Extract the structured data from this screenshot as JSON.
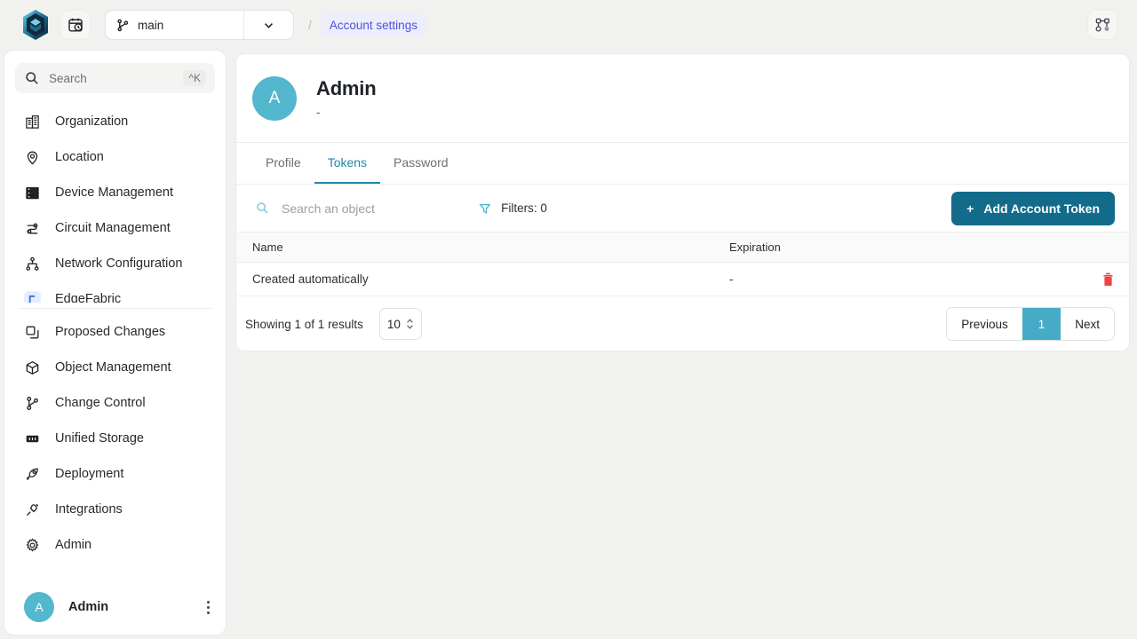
{
  "topbar": {
    "logo_icon": "hexagon-logo-icon",
    "history_icon": "calendar-clock-icon",
    "branch": {
      "icon": "branch-icon",
      "label": "main",
      "caret_icon": "chevron-down-icon"
    },
    "breadcrumb_separator": "/",
    "breadcrumb_current": "Account settings",
    "topology_icon": "topology-nodes-icon"
  },
  "sidebar": {
    "search": {
      "icon": "search-icon",
      "placeholder": "Search",
      "shortcut": "^K"
    },
    "items_upper": [
      {
        "label": "Organization",
        "icon": "building-icon"
      },
      {
        "label": "Location",
        "icon": "map-pin-icon"
      },
      {
        "label": "Device Management",
        "icon": "server-rack-icon"
      },
      {
        "label": "Circuit Management",
        "icon": "circuit-icon"
      },
      {
        "label": "Network Configuration",
        "icon": "network-tree-icon"
      },
      {
        "label": "EdgeFabric",
        "icon": "edge-fabric-icon"
      }
    ],
    "items_lower": [
      {
        "label": "Proposed Changes",
        "icon": "copy-pages-icon"
      },
      {
        "label": "Object Management",
        "icon": "cube-icon"
      },
      {
        "label": "Change Control",
        "icon": "branch-icon"
      },
      {
        "label": "Unified Storage",
        "icon": "storage-icon"
      },
      {
        "label": "Deployment",
        "icon": "rocket-icon"
      },
      {
        "label": "Integrations",
        "icon": "plug-icon"
      },
      {
        "label": "Admin",
        "icon": "gear-icon"
      }
    ],
    "footer": {
      "avatar_initial": "A",
      "name": "Admin",
      "menu_icon": "kebab-menu-icon"
    }
  },
  "main": {
    "header": {
      "avatar_initial": "A",
      "title": "Admin",
      "subtitle": "-"
    },
    "tabs": [
      {
        "label": "Profile",
        "active": false
      },
      {
        "label": "Tokens",
        "active": true
      },
      {
        "label": "Password",
        "active": false
      }
    ],
    "toolbar": {
      "search_icon": "search-icon",
      "search_placeholder": "Search an object",
      "filter_icon": "filter-icon",
      "filters_label": "Filters: 0",
      "add_button": {
        "plus": "+",
        "label": "Add Account Token"
      }
    },
    "table": {
      "columns": [
        "Name",
        "Expiration"
      ],
      "rows": [
        {
          "name": "Created automatically",
          "expiration": "-",
          "delete_icon": "trash-icon"
        }
      ]
    },
    "footer": {
      "showing": "Showing 1 of 1 results",
      "page_size": "10",
      "page_size_caret": "stepper-icon",
      "previous": "Previous",
      "current_page": "1",
      "next": "Next"
    }
  },
  "colors": {
    "accent_teal": "#1e89ab",
    "button_teal": "#136b8b",
    "page_active": "#47aac6",
    "avatar": "#53b7ce",
    "breadcrumb_badge_bg": "#eceefc",
    "breadcrumb_badge_text": "#4f52d8",
    "danger": "#ef4444",
    "page_bg": "#f1f1f0"
  }
}
